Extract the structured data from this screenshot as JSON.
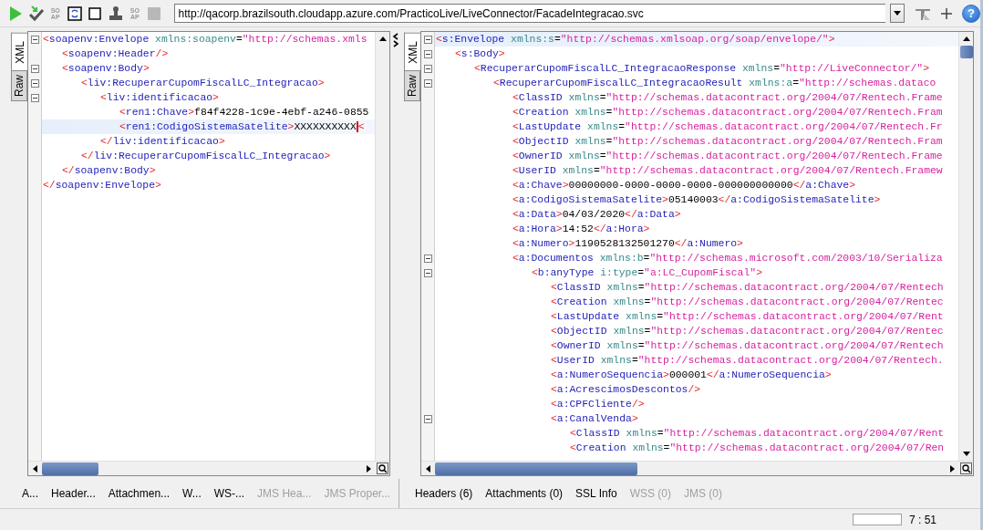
{
  "toolbar": {
    "items": [
      {
        "kind": "run",
        "disabled": false
      },
      {
        "kind": "check",
        "disabled": false
      },
      {
        "kind": "soap",
        "label": "SO AP",
        "disabled": true
      },
      {
        "kind": "refresh",
        "disabled": false
      },
      {
        "kind": "square",
        "disabled": false
      },
      {
        "kind": "stamp",
        "disabled": false
      },
      {
        "kind": "soap",
        "label": "SO AP",
        "disabled": true
      },
      {
        "kind": "stop",
        "disabled": true
      }
    ],
    "url": {
      "value": "http://qacorp.brazilsouth.cloudapp.azure.com/PracticoLive/LiveConnector/FacadeIntegracao.svc"
    },
    "tools": [
      {
        "kind": "options"
      },
      {
        "kind": "add"
      },
      {
        "kind": "help",
        "label": "?"
      }
    ]
  },
  "request": {
    "side_tabs": [
      {
        "label": "XML",
        "selected": true
      },
      {
        "label": "Raw",
        "selected": false
      }
    ],
    "lines": [
      {
        "text": "<soapenv:Envelope xmlns:soapenv=\"http://schemas.xmls",
        "current": false,
        "expanded": true,
        "children": [
          {
            "text": "<soapenv:Header/>",
            "current": false
          },
          {
            "text": "<soapenv:Body>",
            "current": false,
            "expanded": true,
            "children": [
              {
                "text": "<liv:RecuperarCupomFiscalLC_Integracao>",
                "current": false,
                "expanded": true,
                "children": [
                  {
                    "text": "<liv:identificacao>",
                    "current": false,
                    "expanded": true,
                    "children": [
                      {
                        "text": "<ren1:Chave>f84f4228-1c9e-4ebf-a246-0855",
                        "current": false
                      },
                      {
                        "text": "<ren1:CodigoSistemaSatelite>XXXXXXXXXX",
                        "after_caret": "<",
                        "current": true
                      }
                    ]
                  },
                  {
                    "text": "</liv:identificacao>",
                    "current": false
                  }
                ]
              },
              {
                "text": "</liv:RecuperarCupomFiscalLC_Integracao>",
                "current": false
              }
            ]
          },
          {
            "text": "</soapenv:Body>",
            "current": false
          }
        ]
      },
      {
        "text": "</soapenv:Envelope>",
        "current": false
      }
    ],
    "bottom_tabs": [
      {
        "label": "A...",
        "disabled": false
      },
      {
        "label": "Header...",
        "disabled": false
      },
      {
        "label": "Attachmen...",
        "disabled": false
      },
      {
        "label": "W...",
        "disabled": false
      },
      {
        "label": "WS-...",
        "disabled": false
      },
      {
        "label": "JMS Hea...",
        "disabled": true
      },
      {
        "label": "JMS Proper...",
        "disabled": true
      }
    ]
  },
  "response": {
    "side_tabs": [
      {
        "label": "XML",
        "selected": true
      },
      {
        "label": "Raw",
        "selected": false
      }
    ],
    "lines": [
      {
        "text": "<s:Envelope xmlns:s=\"http://schemas.xmlsoap.org/soap/envelope/\">",
        "current": true,
        "expanded": true,
        "children": [
          {
            "text": "<s:Body>",
            "current": false,
            "expanded": true,
            "children": [
              {
                "text": "<RecuperarCupomFiscalLC_IntegracaoResponse xmlns=\"http://LiveConnector/\">",
                "current": false,
                "expanded": true,
                "children": [
                  {
                    "text": "<RecuperarCupomFiscalLC_IntegracaoResult xmlns:a=\"http://schemas.dataco",
                    "current": false,
                    "expanded": true,
                    "children": [
                      {
                        "text": "<ClassID xmlns=\"http://schemas.datacontract.org/2004/07/Rentech.Frame",
                        "current": false
                      },
                      {
                        "text": "<Creation xmlns=\"http://schemas.datacontract.org/2004/07/Rentech.Fram",
                        "current": false
                      },
                      {
                        "text": "<LastUpdate xmlns=\"http://schemas.datacontract.org/2004/07/Rentech.Fr",
                        "current": false
                      },
                      {
                        "text": "<ObjectID xmlns=\"http://schemas.datacontract.org/2004/07/Rentech.Fram",
                        "current": false
                      },
                      {
                        "text": "<OwnerID xmlns=\"http://schemas.datacontract.org/2004/07/Rentech.Frame",
                        "current": false
                      },
                      {
                        "text": "<UserID xmlns=\"http://schemas.datacontract.org/2004/07/Rentech.Framew",
                        "current": false
                      },
                      {
                        "text": "<a:Chave>00000000-0000-0000-0000-000000000000</a:Chave>",
                        "current": false
                      },
                      {
                        "text": "<a:CodigoSistemaSatelite>05140003</a:CodigoSistemaSatelite>",
                        "current": false
                      },
                      {
                        "text": "<a:Data>04/03/2020</a:Data>",
                        "current": false
                      },
                      {
                        "text": "<a:Hora>14:52</a:Hora>",
                        "current": false
                      },
                      {
                        "text": "<a:Numero>1190528132501270</a:Numero>",
                        "current": false
                      },
                      {
                        "text": "<a:Documentos xmlns:b=\"http://schemas.microsoft.com/2003/10/Serializa",
                        "current": false,
                        "expanded": true,
                        "children": [
                          {
                            "text": "<b:anyType i:type=\"a:LC_CupomFiscal\">",
                            "current": false,
                            "expanded": true,
                            "children": [
                              {
                                "text": "<ClassID xmlns=\"http://schemas.datacontract.org/2004/07/Rentech",
                                "current": false
                              },
                              {
                                "text": "<Creation xmlns=\"http://schemas.datacontract.org/2004/07/Rentec",
                                "current": false
                              },
                              {
                                "text": "<LastUpdate xmlns=\"http://schemas.datacontract.org/2004/07/Rent",
                                "current": false
                              },
                              {
                                "text": "<ObjectID xmlns=\"http://schemas.datacontract.org/2004/07/Rentec",
                                "current": false
                              },
                              {
                                "text": "<OwnerID xmlns=\"http://schemas.datacontract.org/2004/07/Rentech",
                                "current": false
                              },
                              {
                                "text": "<UserID xmlns=\"http://schemas.datacontract.org/2004/07/Rentech.",
                                "current": false
                              },
                              {
                                "text": "<a:NumeroSequencia>000001</a:NumeroSequencia>",
                                "current": false
                              },
                              {
                                "text": "<a:AcrescimosDescontos/>",
                                "current": false
                              },
                              {
                                "text": "<a:CPFCliente/>",
                                "current": false
                              },
                              {
                                "text": "<a:CanalVenda>",
                                "current": false,
                                "expanded": true,
                                "children": [
                                  {
                                    "text": "<ClassID xmlns=\"http://schemas.datacontract.org/2004/07/Rent",
                                    "current": false
                                  },
                                  {
                                    "text": "<Creation xmlns=\"http://schemas.datacontract.org/2004/07/Ren",
                                    "current": false
                                  }
                                ]
                              }
                            ]
                          }
                        ]
                      }
                    ]
                  }
                ]
              }
            ]
          }
        ]
      }
    ],
    "bottom_tabs": [
      {
        "label": "Headers (6)",
        "disabled": false
      },
      {
        "label": "Attachments (0)",
        "disabled": false
      },
      {
        "label": "SSL Info",
        "disabled": false
      },
      {
        "label": "WSS (0)",
        "disabled": true
      },
      {
        "label": "JMS (0)",
        "disabled": true
      }
    ]
  },
  "status_bar": {
    "progress": {
      "level": 0
    },
    "position": "7 : 51"
  }
}
